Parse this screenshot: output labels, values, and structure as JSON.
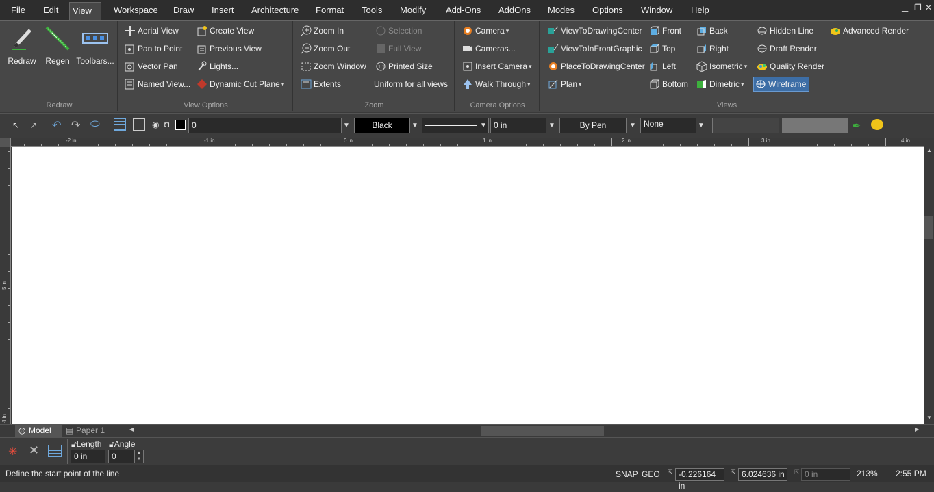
{
  "menu": [
    "File",
    "Edit",
    "View",
    "Workspace",
    "Draw",
    "Insert",
    "Architecture",
    "Format",
    "Tools",
    "Modify",
    "Add-Ons",
    "AddOns",
    "Modes",
    "Options",
    "Window",
    "Help"
  ],
  "ribbon": {
    "redraw": {
      "label": "Redraw",
      "buttons": [
        "Redraw",
        "Regen",
        "Toolbars..."
      ]
    },
    "view_options": {
      "label": "View Options",
      "col1": [
        "Aerial View",
        "Pan to Point",
        "Vector Pan",
        "Named View..."
      ],
      "col2": [
        "Create View",
        "Previous View",
        "Lights...",
        "Dynamic Cut Plane"
      ]
    },
    "zoom": {
      "label": "Zoom",
      "col1": [
        "Zoom In",
        "Zoom Out",
        "Zoom Window",
        "Extents"
      ],
      "col2": [
        "Selection",
        "Full View",
        "Printed Size",
        "Uniform for all views"
      ]
    },
    "camera_options": {
      "label": "Camera Options",
      "items": [
        "Camera",
        "Cameras...",
        "Insert Camera",
        "Walk Through"
      ]
    },
    "views": {
      "label": "Views",
      "col1": [
        "ViewToDrawingCenter",
        "ViewToInFrontGraphic",
        "PlaceToDrawingCenter",
        "Plan"
      ],
      "col2": [
        "Front",
        "Top",
        "Left",
        "Bottom"
      ],
      "col3": [
        "Back",
        "Right",
        "Isometric",
        "Dimetric"
      ],
      "col4": [
        "Hidden Line",
        "Draft Render",
        "Quality Render",
        "Wireframe"
      ],
      "col5": [
        "Advanced Render"
      ]
    }
  },
  "propbar": {
    "layer": "0",
    "color": "Black",
    "thickness": "0 in",
    "pen": "By Pen",
    "fill": "None"
  },
  "ruler": {
    "h": [
      "-2 in",
      "-1 in",
      "0 in",
      "1 in",
      "2 in",
      "3 in",
      "4 in"
    ],
    "v": [
      "5 in",
      "4 in"
    ]
  },
  "tabs": [
    "Model",
    "Paper 1"
  ],
  "cmd": {
    "length_label": "Length",
    "length_value": "0 in",
    "angle_label": "Angle",
    "angle_value": "0"
  },
  "status": {
    "prompt": "Define the start point of the line",
    "snap": "SNAP",
    "geo": "GEO",
    "x": "-0.226164 in",
    "y": "6.024636 in",
    "z": "0 in",
    "zoom": "213%",
    "time": "2:55 PM"
  },
  "colors": {
    "accent": "#3d6ea6",
    "canvas": "#ffffff"
  }
}
